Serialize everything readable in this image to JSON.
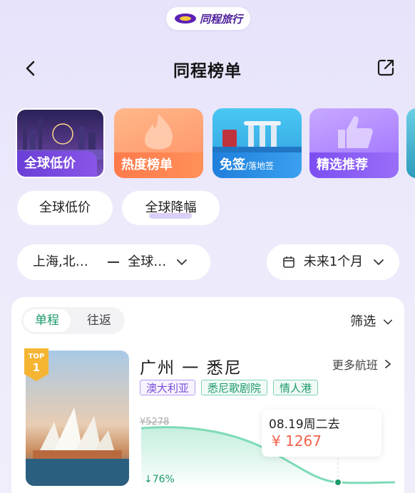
{
  "brand": {
    "name": "同程旅行"
  },
  "header": {
    "title": "同程榜单"
  },
  "categories": [
    {
      "label": "全球低价",
      "sub": ""
    },
    {
      "label": "热度榜单",
      "sub": ""
    },
    {
      "label": "免签",
      "sub": "/落地签"
    },
    {
      "label": "精选推荐",
      "sub": ""
    }
  ],
  "subtabs": [
    "全球低价",
    "全球降幅"
  ],
  "filters": {
    "origin": "上海,北…",
    "destination": "全球…",
    "period": "未来1个月"
  },
  "card": {
    "trip_tabs": [
      "单程",
      "往返"
    ],
    "filter_label": "筛选",
    "badge": "TOP 1",
    "route": "广州 一 悉尼",
    "more_label": "更多航班",
    "tags": [
      "澳大利亚",
      "悉尼歌剧院",
      "情人港"
    ],
    "old_price": "¥5278",
    "date": "08.19周二去",
    "price": "¥ 1267",
    "drop": "↓76%"
  },
  "colors": {
    "accent_green": "#1c9a68",
    "price_red": "#f1624c",
    "brand_purple": "#4b1c9a"
  }
}
